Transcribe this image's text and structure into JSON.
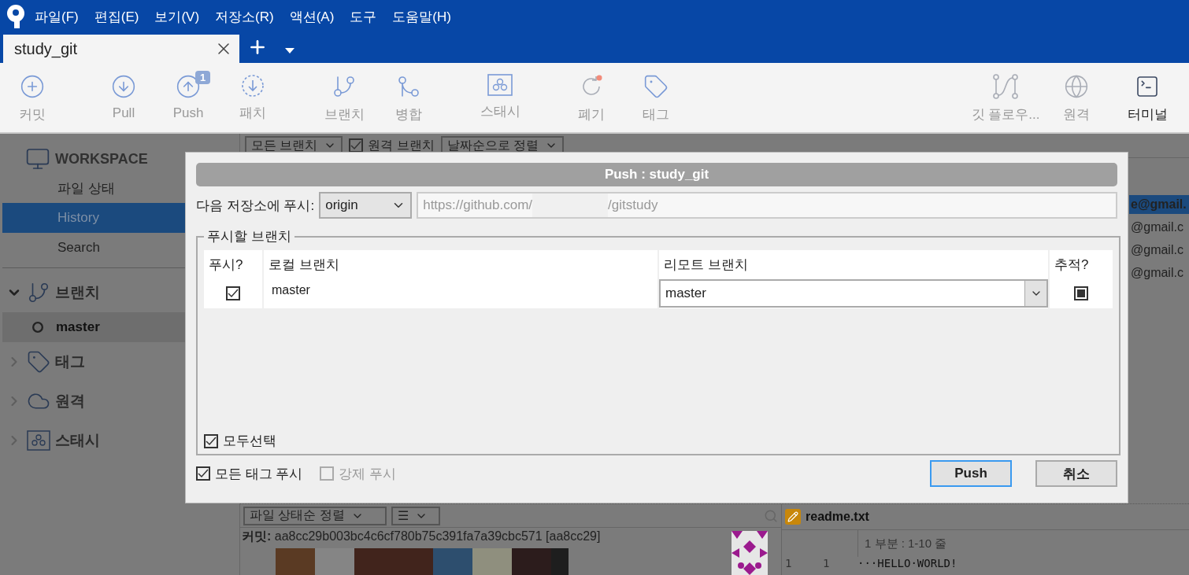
{
  "menu": [
    "파일(F)",
    "편집(E)",
    "보기(V)",
    "저장소(R)",
    "액션(A)",
    "도구",
    "도움말(H)"
  ],
  "tabs": [
    {
      "label": "study_git",
      "selected": true
    }
  ],
  "toolbar": {
    "groups": [
      [
        {
          "label": "커밋",
          "disabled": true
        }
      ],
      [
        {
          "label": "Pull",
          "disabled": true
        },
        {
          "label": "Push",
          "disabled": true,
          "badge": "1"
        },
        {
          "label": "패치",
          "disabled": true
        }
      ],
      [
        {
          "label": "브랜치",
          "disabled": true
        },
        {
          "label": "병합",
          "disabled": true
        }
      ],
      [
        {
          "label": "스태시",
          "disabled": true
        }
      ],
      [
        {
          "label": "폐기",
          "disabled": true
        },
        {
          "label": "태그",
          "disabled": true
        }
      ]
    ],
    "right": [
      {
        "label": "깃 플로우...",
        "disabled": true
      },
      {
        "label": "원격",
        "disabled": true
      },
      {
        "label": "터미널",
        "disabled": false
      }
    ]
  },
  "sidebar": {
    "workspace": {
      "title": "WORKSPACE",
      "items": [
        {
          "label": "파일 상태",
          "selected": false
        },
        {
          "label": "History",
          "selected": true
        },
        {
          "label": "Search",
          "selected": false
        }
      ]
    },
    "sections": [
      {
        "label": "브랜치",
        "expanded": true,
        "children": [
          {
            "label": "master",
            "selected": true
          }
        ]
      },
      {
        "label": "태그",
        "expanded": false
      },
      {
        "label": "원격",
        "expanded": false
      },
      {
        "label": "스태시",
        "expanded": false
      }
    ]
  },
  "filters": [
    {
      "kind": "dropdown",
      "label": "모든 브랜치"
    },
    {
      "kind": "checkbox",
      "label": "원격 브랜치",
      "checked": true
    },
    {
      "kind": "dropdown",
      "label": "날짜순으로 정렬"
    }
  ],
  "commit_list": {
    "emails": [
      {
        "text": "e@gmail.",
        "selected": true
      },
      {
        "text": "@gmail.c",
        "selected": false
      },
      {
        "text": "@gmail.c",
        "selected": false
      },
      {
        "text": "@gmail.c",
        "selected": false
      }
    ]
  },
  "file_bar": {
    "sort": "파일 상태순 정렬",
    "view": "☰",
    "file": "readme.txt"
  },
  "commit_info": "**커밋:** aa8cc29b003bc4c6cf780b75c391fa7a39cbc571 [aa8cc29]",
  "diff": {
    "hunk": "1 부분 : 1-10 줄",
    "lines": [
      {
        "old": "1",
        "new": "1",
        "text": "···HELLO·WORLD!"
      }
    ]
  },
  "dialog": {
    "title": "Push :  study_git",
    "remote_label": "다음 저장소에 푸시:",
    "remote": "origin",
    "url": [
      "https://github.com/",
      "/gitstudy"
    ],
    "group_title": "푸시할 브랜치",
    "columns": [
      "푸시?",
      "로컬 브랜치",
      "리모트 브랜치",
      "추적?"
    ],
    "rows": [
      {
        "push": true,
        "local": "master",
        "remote": "master",
        "track": true
      }
    ],
    "select_all": {
      "label": "모두선택",
      "checked": true
    },
    "options": [
      {
        "label": "모든 태그 푸시",
        "checked": true,
        "disabled": false
      },
      {
        "label": "강제 푸시",
        "checked": false,
        "disabled": true
      }
    ],
    "buttons": [
      {
        "label": "Push",
        "default": true
      },
      {
        "label": "취소",
        "default": false
      }
    ]
  }
}
